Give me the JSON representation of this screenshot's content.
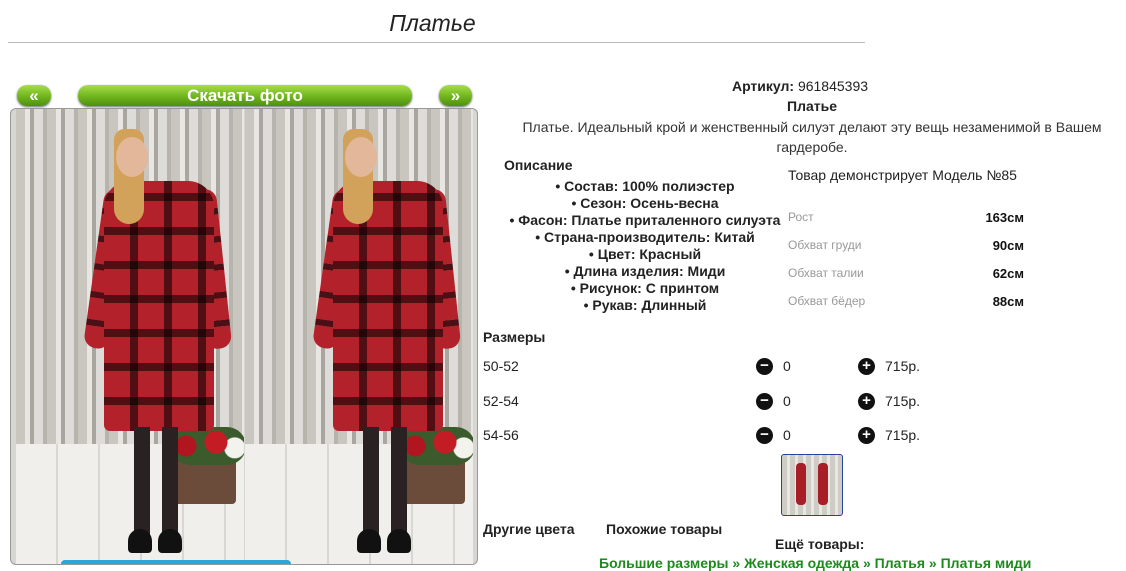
{
  "page": {
    "title": "Платье"
  },
  "gallery": {
    "prev_label": "«",
    "next_label": "»",
    "download_label": "Скачать фото"
  },
  "product": {
    "article_label": "Артикул:",
    "article_value": "961845393",
    "name": "Платье",
    "description": "Платье. Идеальный крой и женственный силуэт делают эту вещь незаменимой в Вашем гардеробе."
  },
  "specs": {
    "heading": "Описание",
    "items": [
      "• Состав: 100% полиэстер",
      "• Сезон: Осень-весна",
      "• Фасон: Платье приталенного силуэта",
      "• Страна-производитель: Китай",
      "• Цвет: Красный",
      "• Длина изделия: Миди",
      "• Рисунок: С принтом",
      "• Рукав: Длинный"
    ]
  },
  "model": {
    "title": "Товар демонстрирует Модель №85",
    "measurements": [
      {
        "label": "Рост",
        "value": "163см"
      },
      {
        "label": "Обхват груди",
        "value": "90см"
      },
      {
        "label": "Обхват талии",
        "value": "62см"
      },
      {
        "label": "Обхват бёдер",
        "value": "88см"
      }
    ]
  },
  "sizes": {
    "heading": "Размеры",
    "rows": [
      {
        "size": "50-52",
        "qty": "0",
        "price": "715р."
      },
      {
        "size": "52-54",
        "qty": "0",
        "price": "715р."
      },
      {
        "size": "54-56",
        "qty": "0",
        "price": "715р."
      }
    ]
  },
  "footer": {
    "other_colors": "Другие цвета",
    "similar": "Похожие товары",
    "more": "Ещё товары:",
    "crumbs": [
      "Большие размеры",
      "Женская одежда",
      "Платья",
      "Платья миди"
    ],
    "crumb_sep": "»"
  },
  "icons": {
    "minus": "minus-circle-icon",
    "plus": "plus-circle-icon"
  },
  "colors": {
    "button_green": "#6fb51e",
    "link_green": "#1c8a1c",
    "dress_red": "#b3212b"
  }
}
